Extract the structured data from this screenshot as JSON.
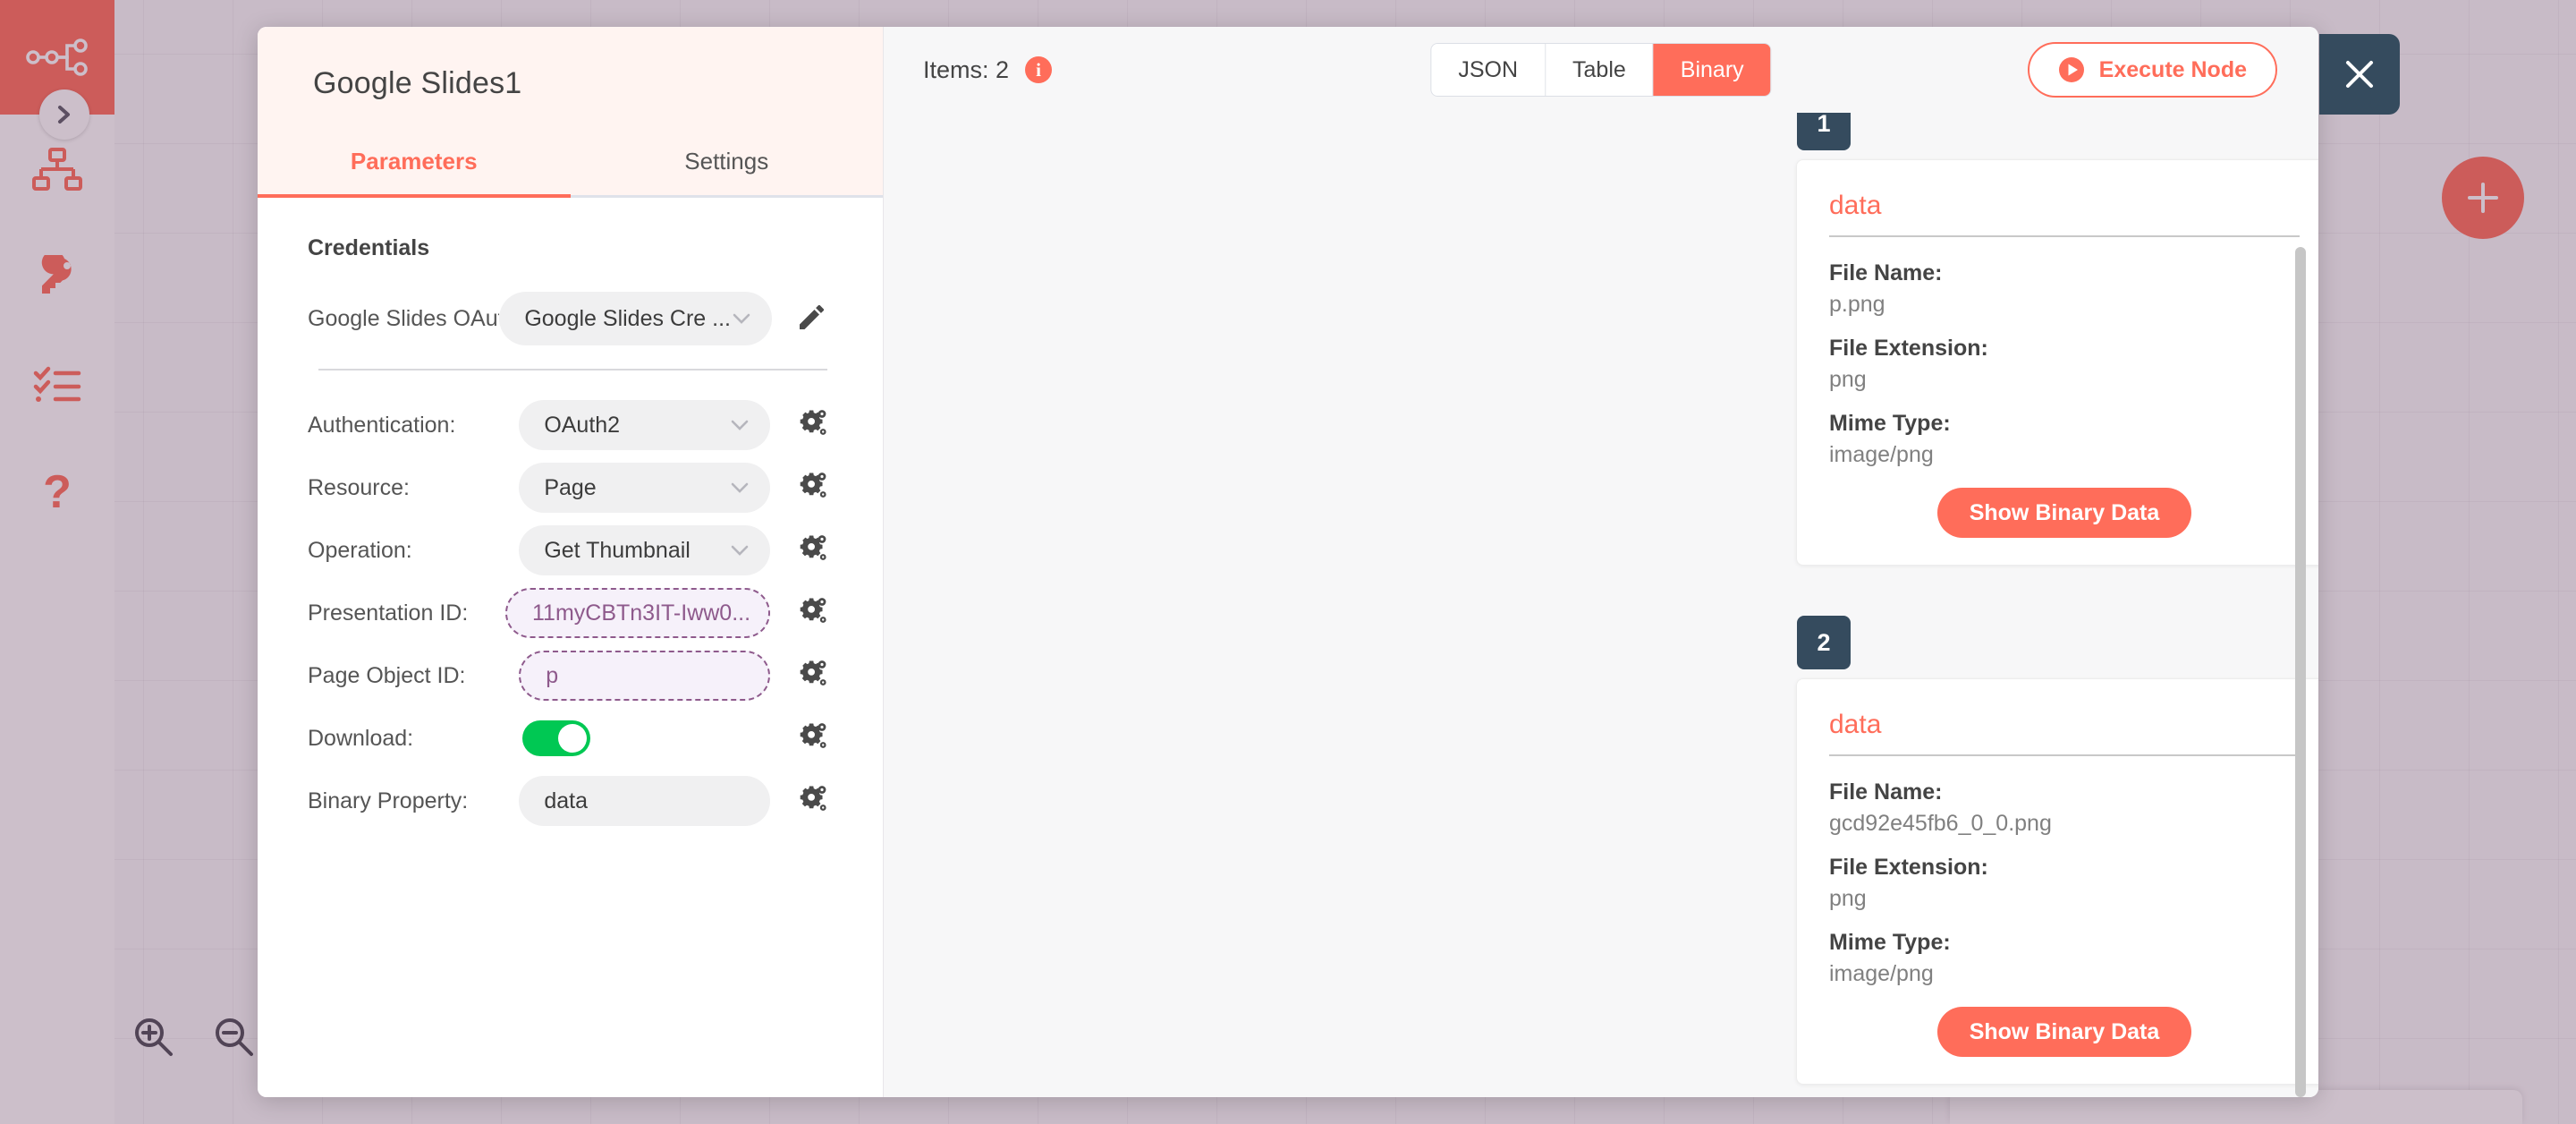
{
  "sidebar": {
    "logo_icon": "n8n-workflow-logo-icon",
    "expand_icon": "chevron-right-icon",
    "items": [
      {
        "icon": "sitemap-workflows-icon",
        "name": "workflows"
      },
      {
        "icon": "key-credentials-icon",
        "name": "credentials"
      },
      {
        "icon": "checklist-executions-icon",
        "name": "executions"
      },
      {
        "icon": "question-mark-help-icon",
        "name": "help"
      }
    ]
  },
  "canvas": {
    "zoom_in_icon": "zoom-in-icon",
    "zoom_out_icon": "zoom-out-icon",
    "add_node_icon": "plus-icon"
  },
  "ndv": {
    "title": "Google Slides1",
    "close_icon": "close-x-icon",
    "tabs": [
      {
        "label": "Parameters",
        "active": true
      },
      {
        "label": "Settings",
        "active": false
      }
    ],
    "parameters": {
      "section_title": "Credentials",
      "credential": {
        "label": "Google Slides OAut...",
        "value": "Google Slides Cre  ...",
        "chevron_icon": "chevron-down-icon",
        "edit_icon": "pencil-icon"
      },
      "rows": [
        {
          "label": "Authentication:",
          "value": "OAuth2",
          "type": "select",
          "gear_icon": "gear-options-icon"
        },
        {
          "label": "Resource:",
          "value": "Page",
          "type": "select",
          "gear_icon": "gear-options-icon"
        },
        {
          "label": "Operation:",
          "value": "Get Thumbnail",
          "type": "select",
          "gear_icon": "gear-options-icon"
        },
        {
          "label": "Presentation ID:",
          "value": "11myCBTn3IT-Iww0...",
          "type": "expression",
          "gear_icon": "gear-options-icon"
        },
        {
          "label": "Page Object ID:",
          "value": "p",
          "type": "expression",
          "gear_icon": "gear-options-icon"
        },
        {
          "label": "Download:",
          "value": "on",
          "type": "toggle",
          "gear_icon": "gear-options-icon"
        },
        {
          "label": "Binary Property:",
          "value": "data",
          "type": "text",
          "gear_icon": "gear-options-icon"
        }
      ]
    },
    "output": {
      "items_label": "Items: 2",
      "info_icon": "info-circle-icon",
      "view_tabs": [
        {
          "label": "JSON",
          "active": false
        },
        {
          "label": "Table",
          "active": false
        },
        {
          "label": "Binary",
          "active": true
        }
      ],
      "execute_button": {
        "label": "Execute Node",
        "icon": "play-circle-icon"
      },
      "field_labels": {
        "file_name": "File Name:",
        "file_extension": "File Extension:",
        "mime_type": "Mime Type:"
      },
      "show_binary_label": "Show Binary Data",
      "items": [
        {
          "index": "1",
          "key": "data",
          "file_name": "p.png",
          "file_extension": "png",
          "mime_type": "image/png"
        },
        {
          "index": "2",
          "key": "data",
          "file_name": "gcd92e45fb6_0_0.png",
          "file_extension": "png",
          "mime_type": "image/png"
        }
      ]
    }
  },
  "colors": {
    "accent": "#ff6d5a",
    "dark": "#354b5e",
    "toggle_on": "#00c853",
    "expression": "#8e5a8c"
  }
}
